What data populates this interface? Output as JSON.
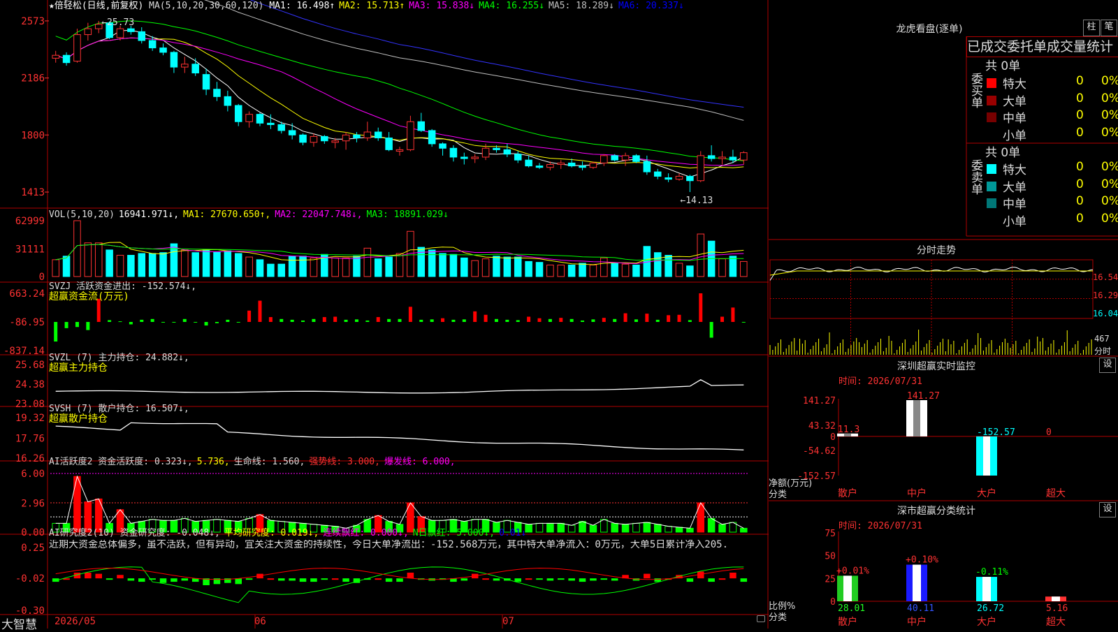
{
  "app": {
    "brand": "大智慧"
  },
  "stock": {
    "name_label": "★倍轻松(日线,前复权)"
  },
  "main_chart": {
    "header_prefix": "MA(5,10,20,30,60,120)",
    "ma_items": [
      {
        "text": "MA1: 16.498↑",
        "color": "#ffffff"
      },
      {
        "text": "MA2: 15.713↑",
        "color": "#ffff00"
      },
      {
        "text": "MA3: 15.838↓",
        "color": "#ff00ff"
      },
      {
        "text": "MA4: 16.255↓",
        "color": "#00ff00"
      },
      {
        "text": "MA5: 18.289↓",
        "color": "#c0c0c0"
      },
      {
        "text": "MA6: 20.337↓",
        "color": "#0000ff"
      }
    ],
    "y_ticks": [
      "2573",
      "2186",
      "1800",
      "1413"
    ],
    "high_label": "←25.73",
    "low_label": "←14.13",
    "ylim": [
      13.8,
      26.2
    ]
  },
  "vol_panel": {
    "header": [
      {
        "text": "VOL(5,10,20)",
        "color": "#dddddd"
      },
      {
        "text": "16941.971↓,",
        "color": "#ffffff"
      },
      {
        "text": "MA1: 27670.650↑,",
        "color": "#ffff00"
      },
      {
        "text": "MA2: 22047.748↓,",
        "color": "#ff00ff"
      },
      {
        "text": "MA3: 18891.029↓",
        "color": "#00ff00"
      }
    ],
    "y_ticks": [
      "62999",
      "31111",
      "0"
    ]
  },
  "svzj_panel": {
    "header": [
      {
        "text": "SVZJ  活跃资金进出: -152.574↓,",
        "color": "#dddddd"
      }
    ],
    "subtitle": "超赢资金流(万元)",
    "y_ticks": [
      "663.24",
      "-86.95",
      "-837.14"
    ]
  },
  "svzl_panel": {
    "header": [
      {
        "text": "SVZL (7) 主力持仓: 24.882↓,",
        "color": "#dddddd"
      }
    ],
    "subtitle": "超赢主力持仓",
    "y_ticks": [
      "25.68",
      "24.38",
      "23.08"
    ]
  },
  "svsh_panel": {
    "header": [
      {
        "text": "SVSH (7) 散户持仓: 16.507↓,",
        "color": "#dddddd"
      }
    ],
    "subtitle": "超赢散户持仓",
    "y_ticks": [
      "19.32",
      "17.76",
      "16.26"
    ]
  },
  "ai_active_panel": {
    "header": [
      {
        "text": "AI活跃度2 资金活跃度: 0.323↓,",
        "color": "#dddddd"
      },
      {
        "text": "5.736,",
        "color": "#ffff00"
      },
      {
        "text": "生命线: 1.560,",
        "color": "#dddddd"
      },
      {
        "text": "强势线: 3.000,",
        "color": "#ff3232"
      },
      {
        "text": "爆发线: 6.000,",
        "color": "#ff00ff"
      }
    ],
    "y_ticks": [
      "6.00",
      "2.96",
      "0.00"
    ]
  },
  "ai_research_panel": {
    "header": [
      {
        "text": "AI研究度2(10) 资金研究度: -0.048↓,",
        "color": "#dddddd"
      },
      {
        "text": "平均研究度: 0.019↓,",
        "color": "#ffff00"
      },
      {
        "text": "连续飘红: 0.000↓,",
        "color": "#ff00ff"
      },
      {
        "text": "N日飘红: 5.000↓,",
        "color": "#00ff00"
      },
      {
        "text": "0.01↓",
        "color": "#0000ff"
      }
    ],
    "comment": "近期大资金总体偏多，虽不活跃，但有异动，宜关注大资金的持续性，今日大单净流出：-152.568万元，其中特大单净流入：0万元，大单5日累计净入205.",
    "y_ticks": [
      "0.25",
      "-0.02",
      "-0.30"
    ]
  },
  "date_axis": {
    "labels": [
      "2026/05",
      "06",
      "07"
    ]
  },
  "right_panel": {
    "dragon_title": "龙虎看盘(逐单)",
    "btn_column": "柱",
    "btn_stroke": "笔",
    "tabs_label": "已成交委托单成交量统计",
    "buy": {
      "group_label": "委买单",
      "total": "共 0单",
      "rows": [
        {
          "name": "特大",
          "count": "0",
          "pct": "0%",
          "color": "#ff0000"
        },
        {
          "name": "大单",
          "count": "0",
          "pct": "0%",
          "color": "#990000"
        },
        {
          "name": "中单",
          "count": "0",
          "pct": "0%",
          "color": "#770000"
        },
        {
          "name": "小单",
          "count": "0",
          "pct": "0%",
          "color": "#000000"
        }
      ]
    },
    "sell": {
      "group_label": "委卖单",
      "total": "共 0单",
      "rows": [
        {
          "name": "特大",
          "count": "0",
          "pct": "0%",
          "color": "#00ffff"
        },
        {
          "name": "大单",
          "count": "0",
          "pct": "0%",
          "color": "#009999"
        },
        {
          "name": "中单",
          "count": "0",
          "pct": "0%",
          "color": "#007777"
        },
        {
          "name": "小单",
          "count": "0",
          "pct": "0%",
          "color": "#000000"
        }
      ]
    },
    "intraday": {
      "title": "分时走势",
      "price_ticks": [
        "16.54",
        "16.29",
        "16.04"
      ],
      "vol_tick": "467",
      "vol_label": "分时"
    },
    "monitor": {
      "title": "深圳超赢实时监控",
      "settings": "设",
      "time": "时间: 2026/07/31",
      "y_ticks": [
        "141.27",
        "43.32",
        "0",
        "-54.62",
        "-152.57"
      ],
      "y_label": "净额(万元)",
      "x_label": "分类",
      "categories": [
        "散户",
        "中户",
        "大户",
        "超大"
      ],
      "values": [
        11.3,
        141.27,
        -152.57,
        0
      ],
      "value_labels": [
        "11.3",
        "141.27",
        "-152.57",
        "0"
      ],
      "ylim": [
        -152.57,
        141.27
      ]
    },
    "stats": {
      "title": "深市超赢分类统计",
      "settings": "设",
      "time": "时间: 2026/07/31",
      "y_ticks": [
        "75",
        "50",
        "25",
        "0"
      ],
      "y_label": "比例%",
      "x_label": "分类",
      "categories": [
        "散户",
        "中户",
        "大户",
        "超大"
      ],
      "values": [
        28.01,
        40.11,
        26.72,
        5.16
      ],
      "value_labels": [
        "28.01",
        "40.11",
        "26.72",
        "5.16"
      ],
      "delta_labels": [
        "+0.01%",
        "+0.10%",
        "-0.11%",
        ""
      ],
      "ylim": [
        0,
        75
      ]
    }
  },
  "chart_data": {
    "type": "candlestick",
    "ohlc": [
      [
        23.2,
        23.7,
        22.9,
        23.4
      ],
      [
        23.4,
        23.6,
        22.7,
        22.9
      ],
      [
        23.0,
        25.2,
        22.9,
        24.8
      ],
      [
        24.8,
        25.6,
        24.4,
        25.2
      ],
      [
        25.2,
        25.73,
        24.9,
        25.5
      ],
      [
        25.6,
        25.7,
        24.5,
        24.6
      ],
      [
        24.6,
        25.4,
        24.4,
        25.2
      ],
      [
        25.2,
        25.4,
        24.8,
        25.0
      ],
      [
        25.0,
        25.3,
        24.2,
        24.4
      ],
      [
        24.4,
        24.7,
        23.7,
        23.9
      ],
      [
        23.9,
        24.2,
        23.4,
        23.6
      ],
      [
        23.6,
        23.7,
        22.2,
        22.6
      ],
      [
        22.6,
        23.3,
        22.2,
        22.8
      ],
      [
        22.8,
        23.2,
        22.0,
        22.2
      ],
      [
        22.1,
        22.5,
        20.7,
        21.1
      ],
      [
        21.1,
        21.6,
        20.3,
        20.6
      ],
      [
        20.6,
        21.0,
        19.6,
        20.0
      ],
      [
        20.0,
        20.1,
        18.6,
        18.9
      ],
      [
        18.9,
        19.6,
        18.5,
        19.4
      ],
      [
        19.4,
        19.5,
        18.6,
        18.8
      ],
      [
        18.8,
        19.4,
        18.4,
        18.7
      ],
      [
        18.7,
        18.9,
        18.1,
        18.3
      ],
      [
        18.3,
        18.8,
        17.7,
        18.0
      ],
      [
        18.0,
        18.1,
        17.3,
        17.5
      ],
      [
        17.5,
        18.1,
        17.2,
        17.9
      ],
      [
        17.9,
        18.0,
        17.4,
        17.6
      ],
      [
        17.5,
        17.8,
        17.1,
        17.6
      ],
      [
        17.6,
        18.2,
        17.0,
        18.0
      ],
      [
        18.0,
        18.2,
        17.5,
        17.8
      ],
      [
        17.8,
        18.9,
        17.6,
        18.2
      ],
      [
        18.2,
        18.5,
        17.6,
        17.8
      ],
      [
        17.8,
        18.2,
        16.9,
        17.0
      ],
      [
        16.9,
        17.2,
        16.6,
        17.0
      ],
      [
        17.0,
        19.3,
        16.9,
        18.9
      ],
      [
        18.9,
        19.5,
        18.2,
        18.3
      ],
      [
        18.3,
        18.4,
        17.2,
        17.4
      ],
      [
        17.4,
        17.5,
        16.6,
        17.1
      ],
      [
        17.1,
        17.3,
        16.2,
        16.5
      ],
      [
        16.5,
        16.8,
        16.0,
        16.4
      ],
      [
        16.4,
        16.7,
        16.1,
        16.5
      ],
      [
        16.5,
        17.4,
        16.3,
        17.1
      ],
      [
        17.1,
        17.3,
        16.8,
        17.0
      ],
      [
        17.0,
        17.4,
        16.5,
        16.7
      ],
      [
        16.7,
        16.9,
        16.1,
        16.3
      ],
      [
        16.3,
        16.6,
        15.8,
        15.9
      ],
      [
        15.9,
        16.1,
        15.7,
        15.8
      ],
      [
        15.8,
        16.2,
        15.6,
        16.0
      ],
      [
        16.0,
        16.3,
        15.7,
        16.1
      ],
      [
        16.1,
        16.4,
        15.8,
        15.9
      ],
      [
        15.9,
        16.2,
        15.6,
        15.8
      ],
      [
        15.8,
        16.2,
        15.7,
        16.1
      ],
      [
        16.1,
        16.7,
        15.9,
        16.6
      ],
      [
        16.6,
        16.7,
        16.2,
        16.3
      ],
      [
        16.3,
        16.8,
        15.9,
        16.6
      ],
      [
        16.6,
        16.7,
        16.1,
        16.2
      ],
      [
        16.2,
        16.6,
        15.3,
        15.5
      ],
      [
        15.5,
        15.7,
        15.0,
        15.2
      ],
      [
        15.1,
        15.4,
        14.8,
        15.0
      ],
      [
        15.0,
        15.4,
        14.9,
        15.2
      ],
      [
        15.2,
        15.3,
        14.13,
        14.9
      ],
      [
        14.9,
        16.9,
        14.8,
        16.6
      ],
      [
        16.6,
        17.3,
        16.2,
        16.4
      ],
      [
        16.4,
        16.9,
        16.0,
        16.5
      ],
      [
        16.5,
        17.0,
        16.1,
        16.3
      ],
      [
        16.3,
        16.9,
        16.0,
        16.8
      ]
    ],
    "volume": [
      19000,
      23000,
      62999,
      38000,
      38000,
      30000,
      24000,
      24000,
      26000,
      26000,
      27000,
      37000,
      30000,
      27000,
      30000,
      28000,
      29000,
      26000,
      22000,
      19000,
      14000,
      14000,
      23000,
      23000,
      21000,
      25000,
      21000,
      21000,
      23000,
      32000,
      20000,
      22000,
      26000,
      51000,
      33000,
      30000,
      26000,
      25000,
      21000,
      18000,
      20000,
      23000,
      22000,
      22000,
      17000,
      16000,
      13000,
      13000,
      13000,
      15000,
      13000,
      21000,
      15000,
      14000,
      13000,
      34000,
      27000,
      24000,
      15000,
      12000,
      48000,
      40000,
      20000,
      23000,
      17000
    ],
    "flow": [
      -600,
      -250,
      -220,
      -300,
      520,
      -40,
      -70,
      -150,
      -30,
      -10,
      -100,
      -90,
      -10,
      -100,
      -180,
      -120,
      -30,
      -90,
      210,
      470,
      40,
      -10,
      -30,
      -50,
      -10,
      40,
      50,
      -30,
      -20,
      -50,
      40,
      -10,
      -10,
      310,
      -30,
      -20,
      10,
      -30,
      -20,
      190,
      100,
      -10,
      -30,
      -40,
      50,
      10,
      -10,
      20,
      -10,
      -50,
      -20,
      20,
      -10,
      140,
      -20,
      130,
      -30,
      90,
      100,
      -40,
      663,
      -500,
      50,
      290,
      -100
    ],
    "ai_active": [
      0.9,
      0.9,
      5.7,
      3.1,
      3.4,
      0.9,
      2.3,
      0.9,
      1.1,
      1.3,
      1.2,
      1.2,
      1.4,
      1.1,
      1.2,
      1.3,
      1.2,
      1.1,
      1.4,
      1.8,
      1.2,
      1.1,
      1.0,
      0.9,
      0.8,
      0.7,
      0.6,
      0.4,
      0.7,
      1.3,
      1.7,
      1.1,
      0.8,
      3.0,
      1.6,
      1.2,
      1.2,
      1.3,
      1.1,
      1.3,
      1.3,
      1.0,
      1.2,
      1.0,
      0.8,
      0.9,
      0.9,
      0.9,
      0.7,
      1.1,
      0.7,
      1.3,
      0.9,
      0.8,
      0.9,
      1.0,
      0.8,
      0.6,
      0.5,
      0.4,
      3.0,
      1.4,
      0.8,
      1.0,
      0.4
    ],
    "ai_research": [
      -0.05,
      -0.02,
      0.03,
      0.03,
      0.02,
      -0.03,
      0.01,
      -0.04,
      -0.05,
      -0.03,
      -0.06,
      -0.05,
      -0.04,
      -0.05,
      -0.08,
      -0.07,
      -0.06,
      -0.07,
      -0.03,
      0.02,
      -0.02,
      -0.04,
      -0.04,
      -0.05,
      -0.05,
      -0.03,
      -0.02,
      -0.05,
      -0.06,
      -0.03,
      -0.02,
      -0.05,
      -0.05,
      0.03,
      -0.03,
      -0.04,
      -0.03,
      -0.05,
      -0.04,
      0.02,
      -0.02,
      -0.04,
      -0.04,
      -0.05,
      -0.02,
      -0.03,
      -0.04,
      -0.03,
      -0.04,
      -0.05,
      -0.04,
      -0.03,
      -0.04,
      0.01,
      -0.04,
      0.02,
      -0.05,
      -0.02,
      0.01,
      -0.05,
      0.04,
      -0.05,
      -0.02,
      0.03,
      -0.05
    ]
  }
}
